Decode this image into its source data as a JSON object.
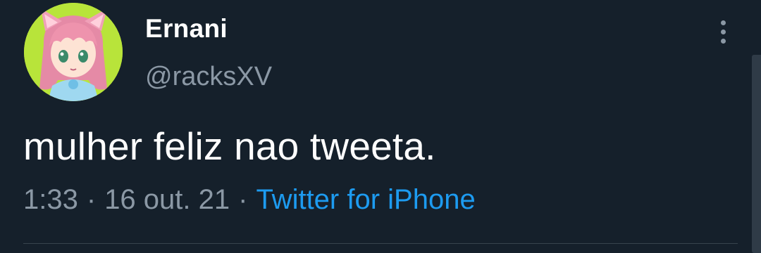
{
  "user": {
    "display_name": "Ernani",
    "handle": "@racksXV",
    "avatar_icon": "anime-girl-avatar"
  },
  "tweet": {
    "text": "mulher feliz nao tweeta.",
    "time": "1:33",
    "date": "16 out. 21",
    "separator": "·",
    "source": "Twitter for iPhone"
  },
  "colors": {
    "background": "#15202b",
    "text_primary": "#ffffff",
    "text_secondary": "#8b98a5",
    "link": "#1d9bf0",
    "divider": "#38444d"
  },
  "icons": {
    "more": "more-vertical-icon"
  }
}
